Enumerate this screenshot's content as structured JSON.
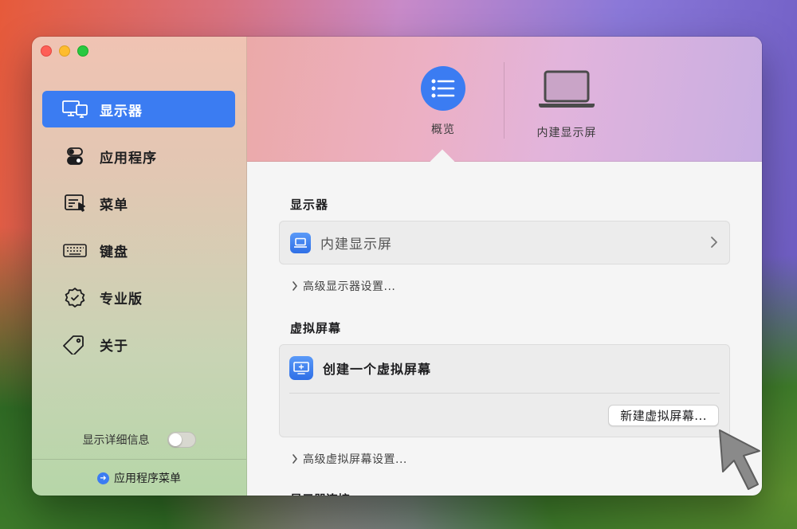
{
  "sidebar": {
    "items": [
      {
        "label": "显示器",
        "icon": "display-icon",
        "active": true
      },
      {
        "label": "应用程序",
        "icon": "toggles-icon",
        "active": false
      },
      {
        "label": "菜单",
        "icon": "menu-icon",
        "active": false
      },
      {
        "label": "键盘",
        "icon": "keyboard-icon",
        "active": false
      },
      {
        "label": "专业版",
        "icon": "seal-check-icon",
        "active": false
      },
      {
        "label": "关于",
        "icon": "tag-icon",
        "active": false
      }
    ],
    "detail_label": "显示详细信息",
    "app_menu_label": "应用程序菜单"
  },
  "header": {
    "tabs": [
      {
        "label": "概览",
        "icon": "list-icon"
      },
      {
        "label": "内建显示屏",
        "icon": "laptop-icon"
      }
    ]
  },
  "main": {
    "displays_title": "显示器",
    "display_item": "内建显示屏",
    "advanced_display": "高级显示器设置...",
    "virtual_title": "虚拟屏幕",
    "virtual_item": "创建一个虚拟屏幕",
    "new_virtual_button": "新建虚拟屏幕...",
    "advanced_virtual": "高级虚拟屏幕设置...",
    "cut_section_title": "显示器连接"
  },
  "colors": {
    "accent": "#3b7cf2"
  }
}
